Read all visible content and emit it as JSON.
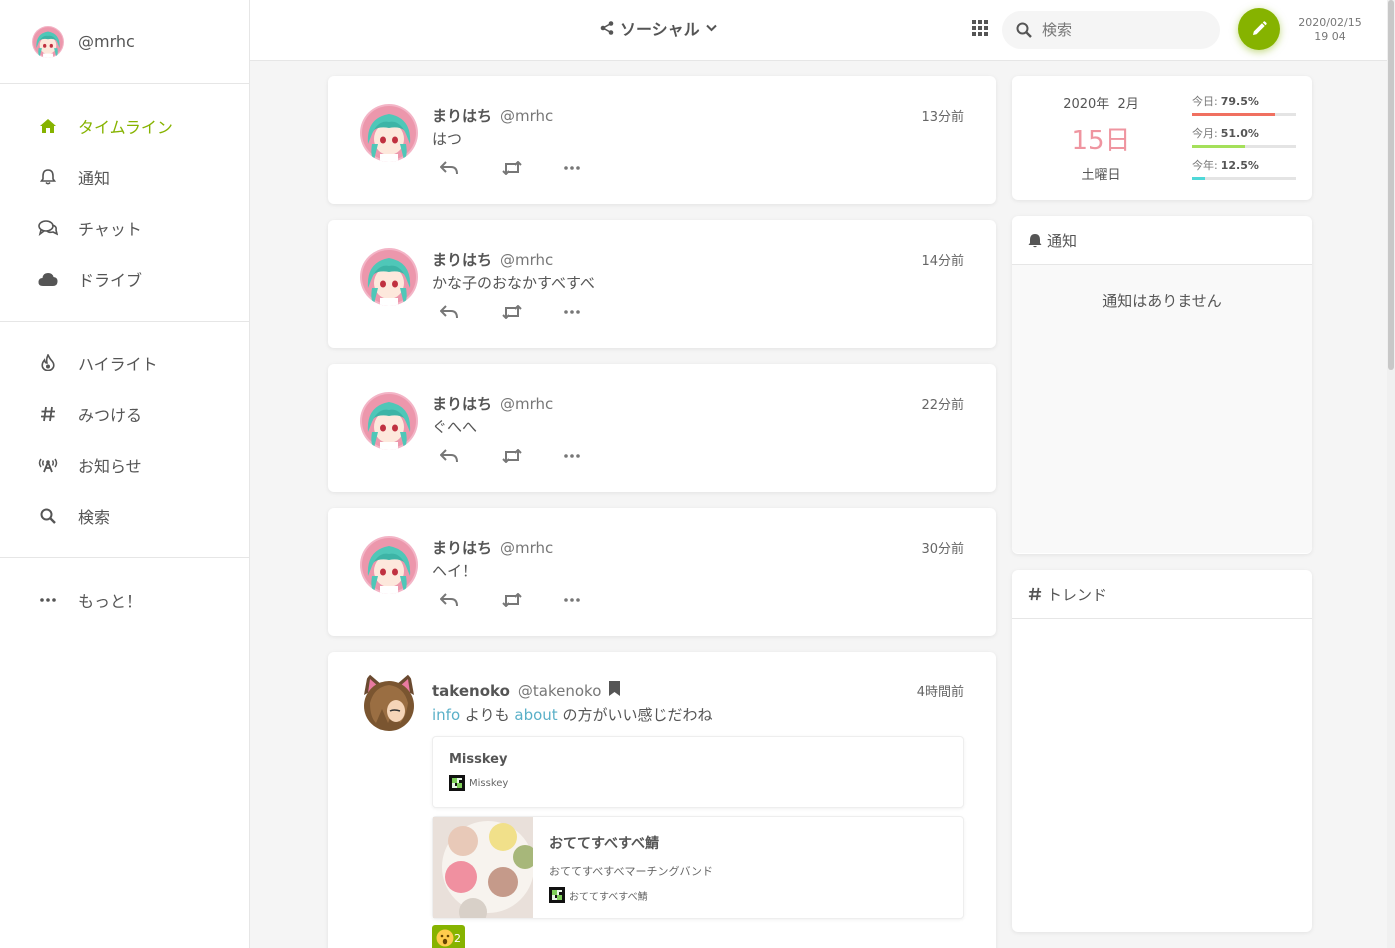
{
  "account": {
    "handle": "@mrhc"
  },
  "nav": {
    "main": [
      {
        "label": "タイムライン",
        "icon": "home-icon",
        "active": true
      },
      {
        "label": "通知",
        "icon": "bell-icon"
      },
      {
        "label": "チャット",
        "icon": "comments-icon"
      },
      {
        "label": "ドライブ",
        "icon": "cloud-icon"
      }
    ],
    "explore": [
      {
        "label": "ハイライト",
        "icon": "fire-icon"
      },
      {
        "label": "みつける",
        "icon": "hashtag-icon"
      },
      {
        "label": "お知らせ",
        "icon": "broadcast-tower-icon"
      },
      {
        "label": "検索",
        "icon": "search-icon"
      }
    ],
    "more": {
      "label": "もっと！",
      "icon": "ellipsis-icon"
    }
  },
  "header": {
    "title": "ソーシャル",
    "search_placeholder": "検索",
    "clock_date": "2020/02/15",
    "clock_time": "19 04"
  },
  "notes": [
    {
      "name": "まりはち",
      "user": "@mrhc",
      "time": "13分前",
      "text": "はつ"
    },
    {
      "name": "まりはち",
      "user": "@mrhc",
      "time": "14分前",
      "text": "かな子のおなかすべすべ"
    },
    {
      "name": "まりはち",
      "user": "@mrhc",
      "time": "22分前",
      "text": "ぐへへ"
    },
    {
      "name": "まりはち",
      "user": "@mrhc",
      "time": "30分前",
      "text": "ヘイ！"
    }
  ],
  "note5": {
    "name": "takenoko",
    "user": "@takenoko",
    "time": "4時間前",
    "mention1": "info",
    "text_mid": " よりも ",
    "mention2": "about",
    "text_end": " の方がいい感じだわね",
    "preview1": {
      "title": "Misskey",
      "site": "Misskey"
    },
    "preview2": {
      "title": "おててすべすべ鯖",
      "desc": "おててすべすべマーチングバンド",
      "site": "おててすべすべ鯖"
    },
    "reaction_count": "2"
  },
  "calendar": {
    "year_month": "2020年  2月",
    "day": "15日",
    "weekday": "土曜日",
    "bars": [
      {
        "label": "今日:",
        "value": "79.5%",
        "fraction": 0.795,
        "color": "#f07060"
      },
      {
        "label": "今月:",
        "value": "51.0%",
        "fraction": 0.51,
        "color": "#a4e05a"
      },
      {
        "label": "今年:",
        "value": "12.5%",
        "fraction": 0.125,
        "color": "#4fd8d8"
      }
    ]
  },
  "widgets": {
    "notifications": {
      "title": "通知",
      "empty": "通知はありません"
    },
    "trends": {
      "title": "トレンド"
    }
  },
  "colors": {
    "accent": "#86b300",
    "mention": "#5ab0c8",
    "day": "#ef95a0"
  }
}
